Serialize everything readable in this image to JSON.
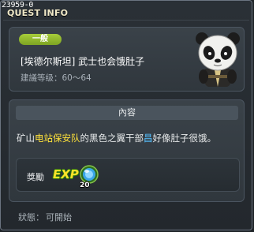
{
  "quest_id": "23959-0",
  "window_title": "QUEST INFO",
  "quest": {
    "category_badge": "一般",
    "name": "[埃德尔斯坦] 武士也会饿肚子",
    "level_requirement": "建議等级：60～64",
    "npc_icon": "panda-samurai-npc-icon"
  },
  "content": {
    "header": "內容",
    "description_prefix": "矿山",
    "description_highlight1": "电站保安队",
    "description_middle": "的黑色之翼干部",
    "description_highlight2": "昌",
    "description_suffix": "好像肚子很饿。"
  },
  "reward": {
    "label": "獎勵",
    "exp_label": "EXP",
    "item_icon": "blue-orb-item-icon",
    "item_quantity": "20"
  },
  "status": {
    "label": "狀態：",
    "value": "可開始"
  },
  "colors": {
    "badge_green": "#8fb52c",
    "highlight_yellow": "#ffe23a",
    "highlight_blue": "#55c0ff",
    "exp_yellow": "#ffe22a"
  }
}
